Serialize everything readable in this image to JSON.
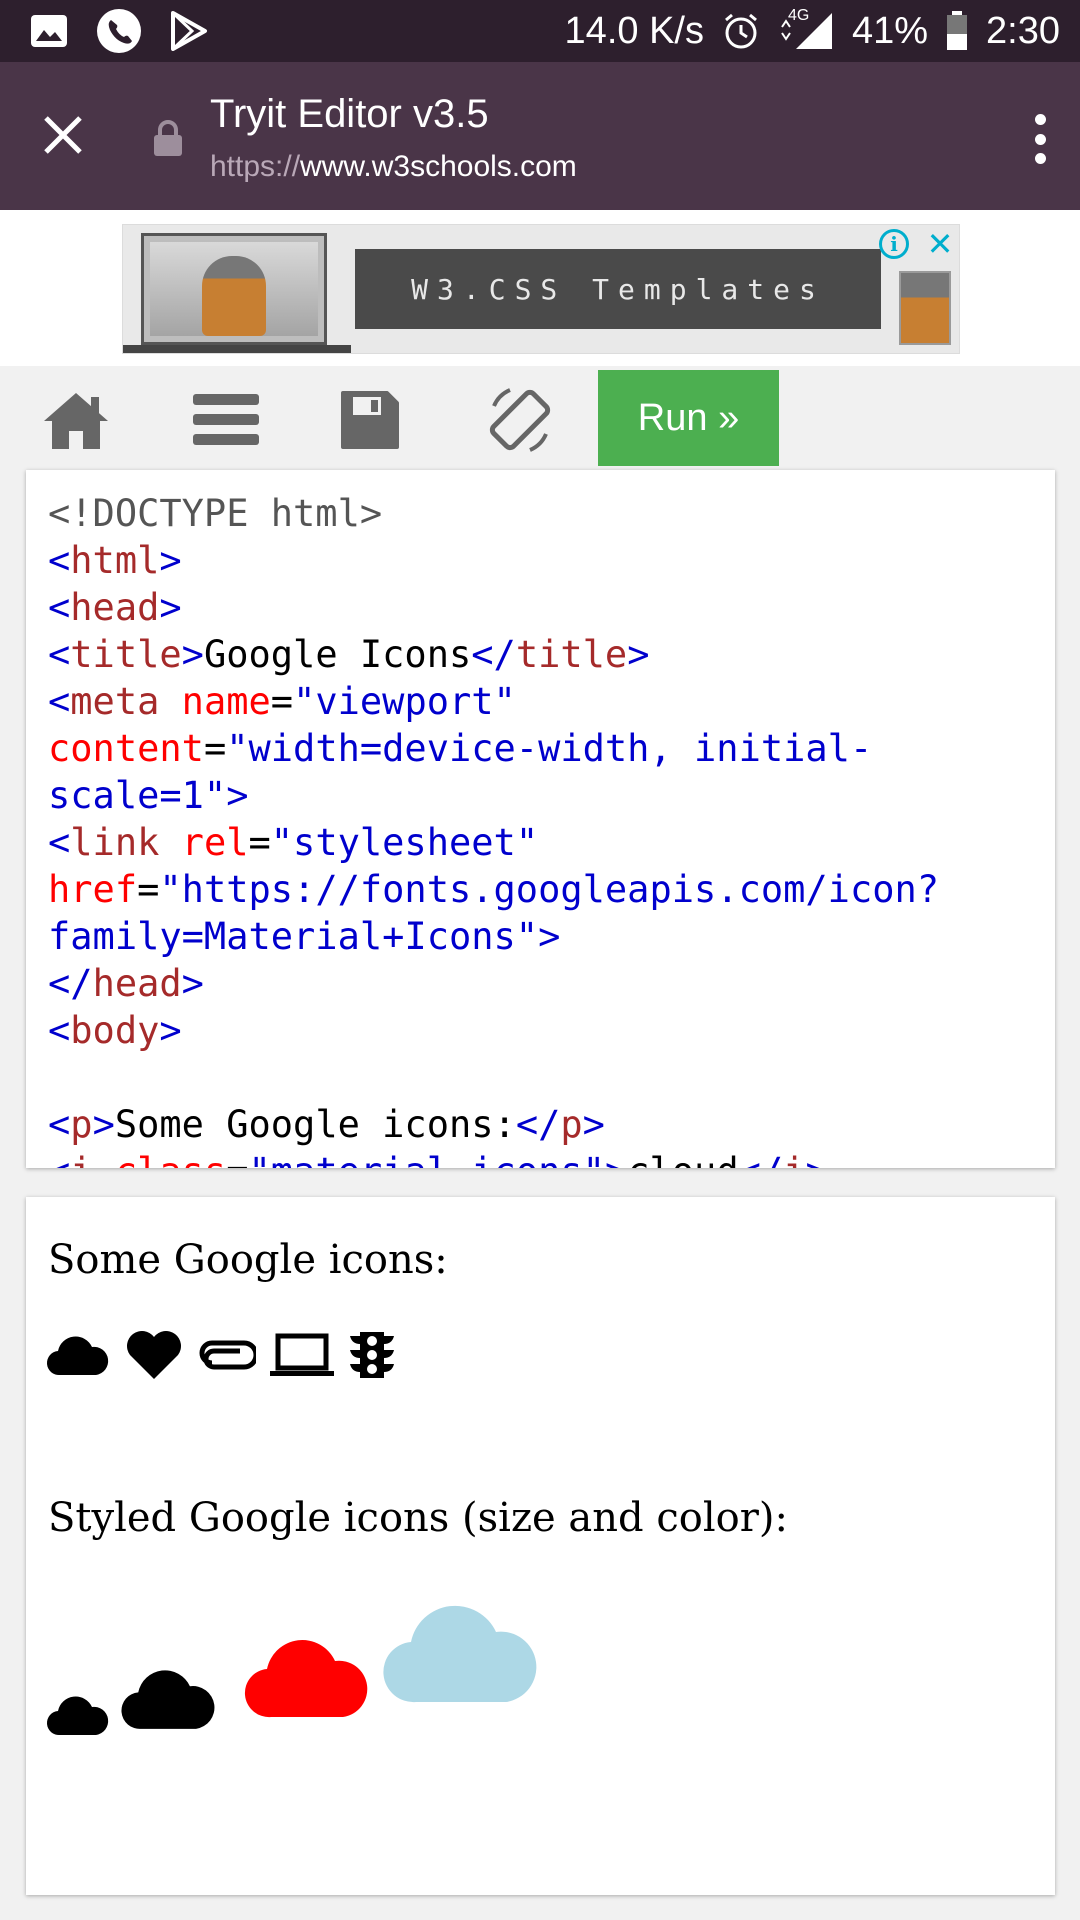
{
  "status_bar": {
    "network_speed": "14.0 K/s",
    "network_type": "4G",
    "battery": "41%",
    "time": "2:30",
    "icons": [
      "image-icon",
      "phone-icon",
      "play-store-icon",
      "alarm-icon",
      "signal-icon",
      "battery-icon"
    ]
  },
  "browser": {
    "title": "Tryit Editor v3.5",
    "url_protocol": "https://",
    "url_host": "www.w3schools.com"
  },
  "ad": {
    "label": "W3.CSS Templates",
    "info_glyph": "i",
    "close_glyph": "✕"
  },
  "toolbar": {
    "run_label": "Run »",
    "icons": [
      "home-icon",
      "menu-icon",
      "save-icon",
      "rotate-icon"
    ]
  },
  "code_lines": [
    [
      [
        "doc",
        "<!DOCTYPE html>"
      ]
    ],
    [
      [
        "br",
        "<"
      ],
      [
        "tag",
        "html"
      ],
      [
        "br",
        ">"
      ]
    ],
    [
      [
        "br",
        "<"
      ],
      [
        "tag",
        "head"
      ],
      [
        "br",
        ">"
      ]
    ],
    [
      [
        "br",
        "<"
      ],
      [
        "tag",
        "title"
      ],
      [
        "br",
        ">"
      ],
      [
        "txt",
        "Google Icons"
      ],
      [
        "br",
        "</"
      ],
      [
        "tag",
        "title"
      ],
      [
        "br",
        ">"
      ]
    ],
    [
      [
        "br",
        "<"
      ],
      [
        "tag",
        "meta "
      ],
      [
        "attr",
        "name"
      ],
      [
        "txt",
        "="
      ],
      [
        "val",
        "\"viewport\""
      ]
    ],
    [
      [
        "attr",
        "content"
      ],
      [
        "txt",
        "="
      ],
      [
        "val",
        "\"width=device-width, initial-"
      ]
    ],
    [
      [
        "val",
        "scale=1\""
      ],
      [
        "br",
        ">"
      ]
    ],
    [
      [
        "br",
        "<"
      ],
      [
        "tag",
        "link "
      ],
      [
        "attr",
        "rel"
      ],
      [
        "txt",
        "="
      ],
      [
        "val",
        "\"stylesheet\""
      ]
    ],
    [
      [
        "attr",
        "href"
      ],
      [
        "txt",
        "="
      ],
      [
        "val",
        "\"https://fonts.googleapis.com/icon?"
      ]
    ],
    [
      [
        "val",
        "family=Material+Icons\""
      ],
      [
        "br",
        ">"
      ]
    ],
    [
      [
        "br",
        "</"
      ],
      [
        "tag",
        "head"
      ],
      [
        "br",
        ">"
      ]
    ],
    [
      [
        "br",
        "<"
      ],
      [
        "tag",
        "body"
      ],
      [
        "br",
        ">"
      ]
    ],
    [
      [
        "txt",
        ""
      ]
    ],
    [
      [
        "br",
        "<"
      ],
      [
        "tag",
        "p"
      ],
      [
        "br",
        ">"
      ],
      [
        "txt",
        "Some Google icons:"
      ],
      [
        "br",
        "</"
      ],
      [
        "tag",
        "p"
      ],
      [
        "br",
        ">"
      ]
    ],
    [
      [
        "br",
        "<"
      ],
      [
        "tag",
        "i "
      ],
      [
        "attr",
        "class"
      ],
      [
        "txt",
        "="
      ],
      [
        "val",
        "\"material-icons\""
      ],
      [
        "br",
        ">"
      ],
      [
        "txt",
        "cloud"
      ],
      [
        "br",
        "</"
      ],
      [
        "tag",
        "i"
      ],
      [
        "br",
        ">"
      ]
    ]
  ],
  "colors": {
    "doc": "#555555",
    "tag": "#a52a2a",
    "br": "#0000cd",
    "attr": "#ff0000",
    "val": "#0000cd",
    "txt": "#000000",
    "run_button": "#4caf50",
    "browser_bar": "#4a3548",
    "cloud_red": "#ff0000",
    "cloud_lightblue": "#add8e6"
  },
  "result": {
    "heading1": "Some Google icons:",
    "icons": [
      "cloud-icon",
      "favorite-icon",
      "attachment-icon",
      "computer-icon",
      "traffic-icon"
    ],
    "heading2": "Styled Google icons (size and color):",
    "styled_clouds": [
      {
        "name": "cloud-icon",
        "color": "#000000"
      },
      {
        "name": "cloud-icon",
        "color": "#000000"
      },
      {
        "name": "cloud-icon",
        "color": "#ff0000"
      },
      {
        "name": "cloud-icon",
        "color": "#add8e6"
      }
    ]
  }
}
